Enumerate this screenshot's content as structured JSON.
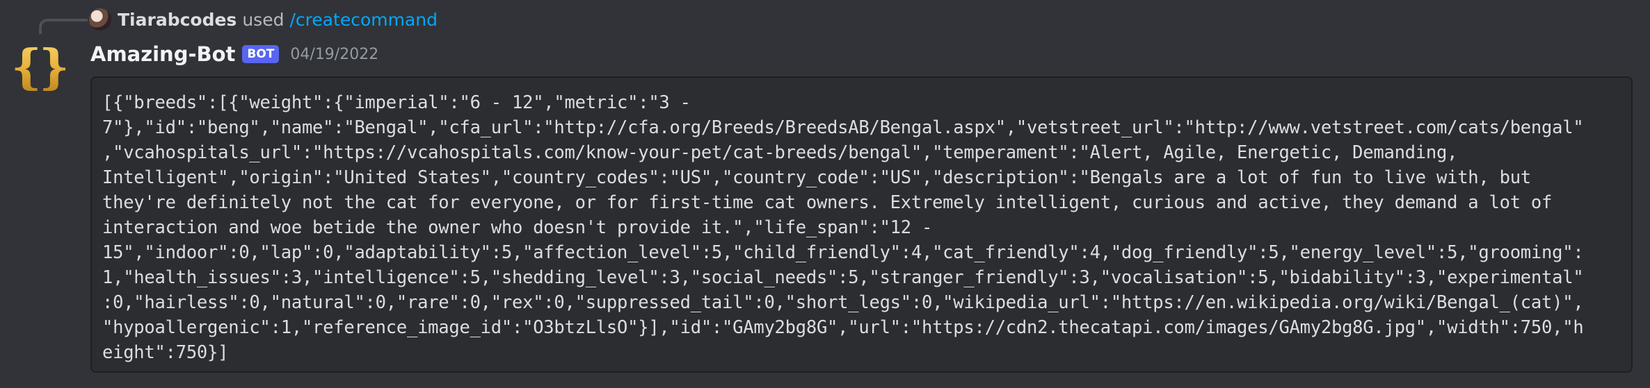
{
  "reply": {
    "user": "Tiarabcodes",
    "used_text": "used",
    "command": "/createcommand"
  },
  "message": {
    "author": "Amazing-Bot",
    "tag": "BOT",
    "timestamp": "04/19/2022",
    "code_lines": [
      "[{\"breeds\":[{\"weight\":{\"imperial\":\"6 - 12\",\"metric\":\"3 -",
      "7\"},\"id\":\"beng\",\"name\":\"Bengal\",\"cfa_url\":\"http://cfa.org/Breeds/BreedsAB/Bengal.aspx\",\"vetstreet_url\":\"http://www.vetstreet.com/cats/bengal\"",
      ",\"vcahospitals_url\":\"https://vcahospitals.com/know-your-pet/cat-breeds/bengal\",\"temperament\":\"Alert, Agile, Energetic, Demanding,",
      "Intelligent\",\"origin\":\"United States\",\"country_codes\":\"US\",\"country_code\":\"US\",\"description\":\"Bengals are a lot of fun to live with, but",
      "they're definitely not the cat for everyone, or for first-time cat owners. Extremely intelligent, curious and active, they demand a lot of",
      "interaction and woe betide the owner who doesn't provide it.\",\"life_span\":\"12 -",
      "15\",\"indoor\":0,\"lap\":0,\"adaptability\":5,\"affection_level\":5,\"child_friendly\":4,\"cat_friendly\":4,\"dog_friendly\":5,\"energy_level\":5,\"grooming\":",
      "1,\"health_issues\":3,\"intelligence\":5,\"shedding_level\":3,\"social_needs\":5,\"stranger_friendly\":3,\"vocalisation\":5,\"bidability\":3,\"experimental\"",
      ":0,\"hairless\":0,\"natural\":0,\"rare\":0,\"rex\":0,\"suppressed_tail\":0,\"short_legs\":0,\"wikipedia_url\":\"https://en.wikipedia.org/wiki/Bengal_(cat)\",",
      "\"hypoallergenic\":1,\"reference_image_id\":\"O3btzLlsO\"}],\"id\":\"GAmy2bg8G\",\"url\":\"https://cdn2.thecatapi.com/images/GAmy2bg8G.jpg\",\"width\":750,\"h",
      "eight\":750}]"
    ]
  },
  "colors": {
    "background": "#313338",
    "code_background": "#2b2d31",
    "link": "#00a8fc",
    "bot_tag": "#5865f2",
    "avatar_gold": "#e8b23a"
  },
  "icons": {
    "bot_avatar": "curly-braces-icon",
    "reply_avatar": "user-avatar"
  }
}
